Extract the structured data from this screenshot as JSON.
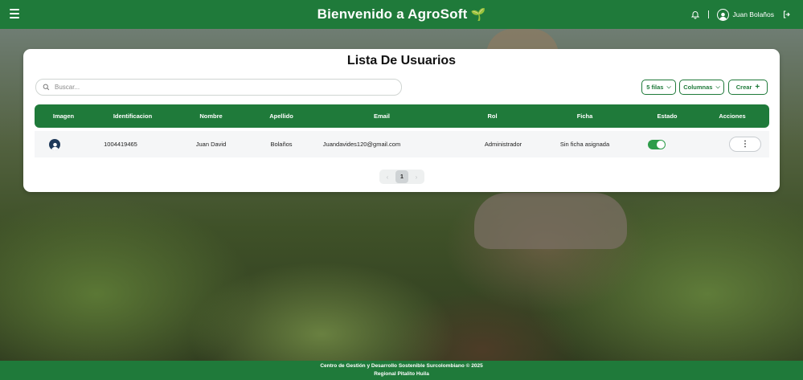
{
  "header": {
    "menu_icon": "hamburger-icon",
    "title": "Bienvenido a AgroSoft",
    "title_icon": "sprout-icon",
    "notification_icon": "bell-icon",
    "user_name": "Juan Bolaños",
    "user_icon": "user-circle-icon",
    "logout_icon": "logout-icon"
  },
  "page": {
    "title": "Lista De Usuarios",
    "search_placeholder": "Buscar...",
    "rows_select_label": "5 filas",
    "columns_button_label": "Columnas",
    "create_button_label": "Crear"
  },
  "table": {
    "headers": [
      "Imagen",
      "Identificacion",
      "Nombre",
      "Apellido",
      "Email",
      "Rol",
      "Ficha",
      "Estado",
      "Acciones"
    ],
    "rows": [
      {
        "identificacion": "1004419465",
        "nombre": "Juan David",
        "apellido": "Bolaños",
        "email": "Juandavides120@gmail.com",
        "rol": "Administrador",
        "ficha": "Sin ficha asignada",
        "estado": true,
        "acciones_label": "⋮"
      }
    ]
  },
  "pagination": {
    "prev": "‹",
    "current": "1",
    "next": "›"
  },
  "footer": {
    "line1": "Centro de Gestión y Desarrollo Sostenible Surcolombiano © 2025",
    "line2": "Regional Pitalito Huila"
  },
  "colors": {
    "primary": "#1f7a3a",
    "toggle_on": "#2e9c4a"
  }
}
